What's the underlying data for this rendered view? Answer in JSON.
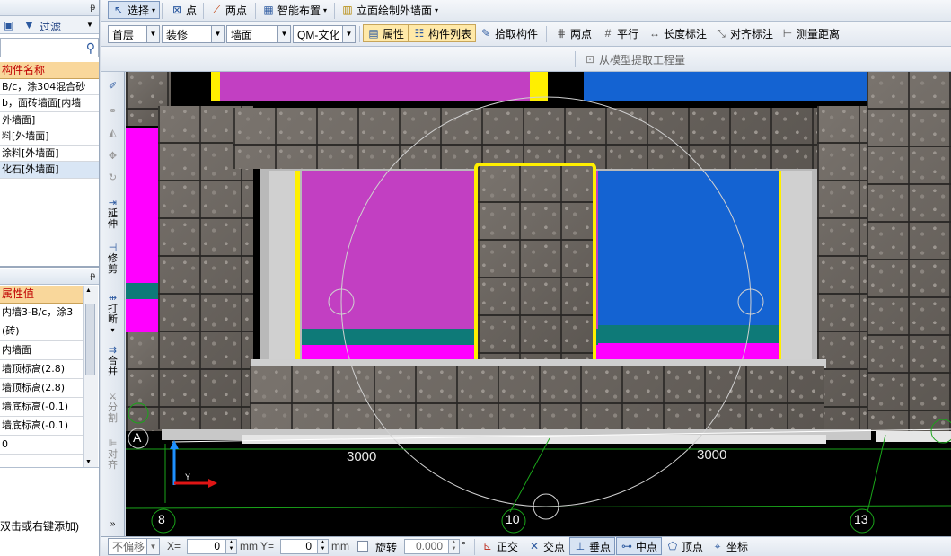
{
  "left_panel": {
    "filter_label": "过滤",
    "component_table": {
      "header": "构件名称",
      "rows": [
        "B/c，涂304混合砂",
        "b，面砖墙面[内墙",
        "外墙面]",
        "料[外墙面]",
        "涂料[外墙面]",
        "化石[外墙面]"
      ]
    },
    "property_table": {
      "header": "属性值",
      "rows": [
        "内墙3-B/c，涂3",
        "(砖)",
        "内墙面",
        "墙顶标高(2.8)",
        "墙顶标高(2.8)",
        "墙底标高(-0.1)",
        "墙底标高(-0.1)",
        "0"
      ]
    },
    "hint_text": "双击或右键添加)"
  },
  "toolbar1": {
    "select": "选择",
    "point": "点",
    "two_point": "两点",
    "smart_layout": "智能布置",
    "elevation_wall": "立面绘制外墙面"
  },
  "toolbar2": {
    "floor": "首层",
    "category": "装修",
    "type": "墙面",
    "component": "QM-文化",
    "property": "属性",
    "component_list": "构件列表",
    "pick": "拾取构件",
    "two_point": "两点",
    "parallel": "平行",
    "length_dim": "长度标注",
    "align_dim": "对齐标注",
    "measure": "测量距离"
  },
  "toolbar3": {
    "extract": "从模型提取工程量"
  },
  "vertical_tools": [
    "延伸",
    "修剪",
    "打断",
    "合并",
    "分割",
    "对齐"
  ],
  "viewport": {
    "axis_a": "A",
    "dim_left": "3000",
    "dim_right": "3000",
    "axis_8": "8",
    "axis_10": "10",
    "axis_13": "13",
    "colors": {
      "pink": "#c23fc2",
      "blue": "#1463d2",
      "magenta": "#ff00ff",
      "teal": "#0e7a78",
      "yellow": "#ffef00",
      "highlight": "#ffef00",
      "grid_green": "#1aa51a"
    }
  },
  "statusbar": {
    "offset": "不偏移",
    "x_label": "X=",
    "x_value": "0",
    "x_unit": "mm",
    "y_label": "Y=",
    "y_value": "0",
    "y_unit": "mm",
    "rotate": "旋转",
    "rotate_value": "0.000",
    "degree": "°",
    "ortho": "正交",
    "intersection": "交点",
    "perpendicular": "垂点",
    "midpoint": "中点",
    "vertex": "顶点",
    "coordinate": "坐标"
  }
}
